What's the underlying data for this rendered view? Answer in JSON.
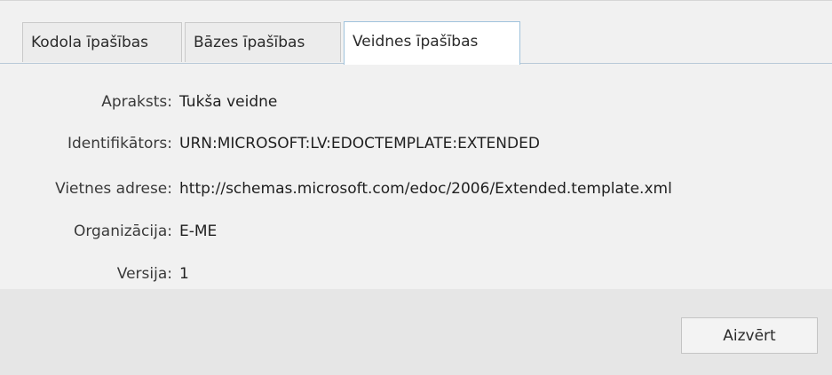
{
  "tabs": [
    {
      "label": "Kodola īpašības"
    },
    {
      "label": "Bāzes īpašības"
    },
    {
      "label": "Veidnes īpašības"
    }
  ],
  "active_tab": "Veidnes īpašības",
  "properties": [
    {
      "label": "Apraksts:",
      "value": "Tukša veidne"
    },
    {
      "label": "Identifikātors:",
      "value": "URN:MICROSOFT:LV:EDOCTEMPLATE:EXTENDED"
    },
    {
      "label": "Vietnes adrese:",
      "value": "http://schemas.microsoft.com/edoc/2006/Extended.template.xml"
    },
    {
      "label": "Organizācija:",
      "value": "E-ME"
    },
    {
      "label": "Versija:",
      "value": "1"
    }
  ],
  "footer": {
    "close_label": "Aizvērt"
  },
  "colors": {
    "active_tab_border": "#9fc2dc",
    "background": "#f1f1f1",
    "footer": "#e6e6e6"
  }
}
